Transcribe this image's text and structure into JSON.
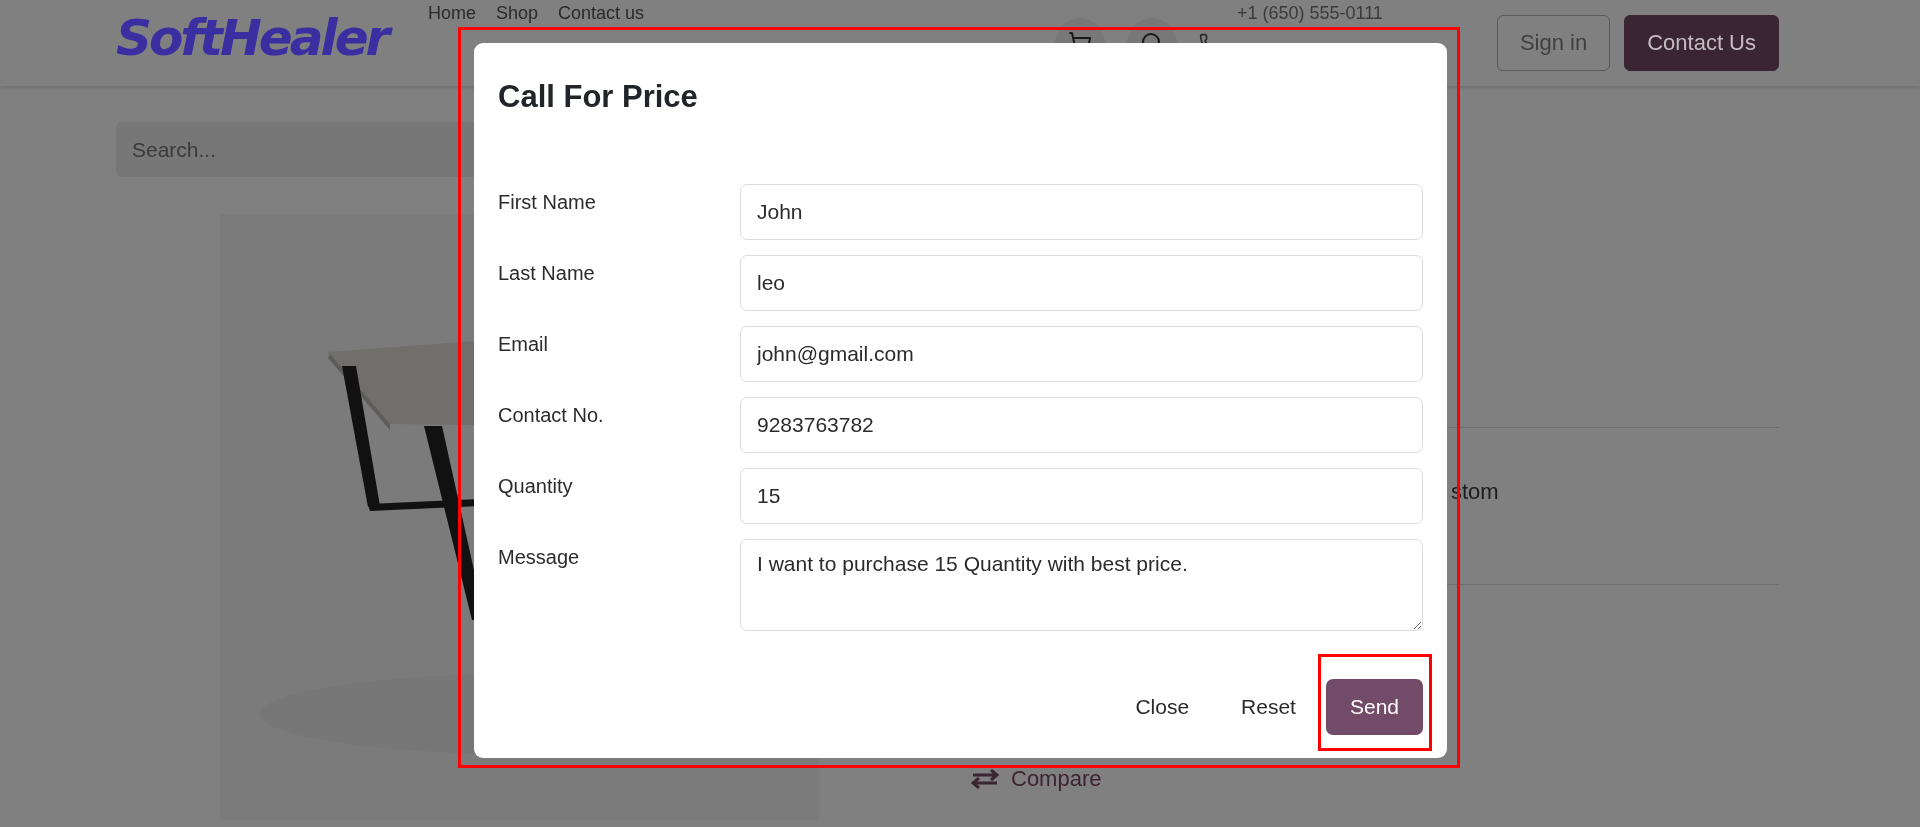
{
  "header": {
    "logo": "SoftHealer",
    "nav": [
      "Home",
      "Shop",
      "Contact us"
    ],
    "phone": "+1 (650) 555-0111",
    "buttons": [
      {
        "label": "Sign in",
        "kind": "outline"
      },
      {
        "label": "Contact Us",
        "kind": "primary"
      }
    ]
  },
  "search": {
    "placeholder": "Search..."
  },
  "product": {
    "text_fragment": "stom",
    "compare": "Compare"
  },
  "dialog": {
    "title": "Call For Price",
    "highlighted": true,
    "fields": [
      {
        "label": "First Name",
        "value": "John",
        "kind": "input"
      },
      {
        "label": "Last Name",
        "value": "leo",
        "kind": "input"
      },
      {
        "label": "Email",
        "value": "john@gmail.com",
        "kind": "input"
      },
      {
        "label": "Contact No.",
        "value": "9283763782",
        "kind": "input"
      },
      {
        "label": "Quantity",
        "value": "15",
        "kind": "input"
      },
      {
        "label": "Message",
        "value": "I want to purchase 15 Quantity with best price.",
        "kind": "textarea"
      }
    ],
    "buttons": [
      {
        "label": "Close",
        "kind": "link",
        "highlighted": false
      },
      {
        "label": "Reset",
        "kind": "link",
        "highlighted": false
      },
      {
        "label": "Send",
        "kind": "primary",
        "highlighted": true
      }
    ]
  }
}
